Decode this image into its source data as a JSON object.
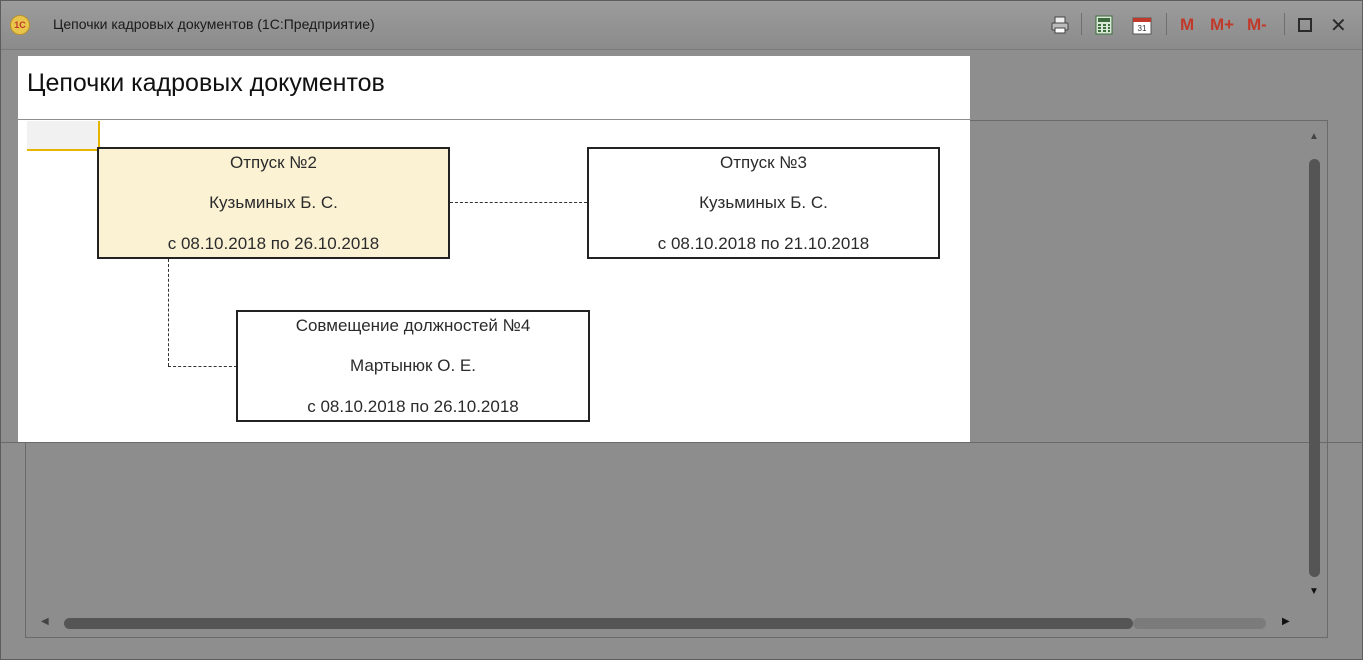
{
  "window": {
    "title": "Цепочки кадровых документов  (1С:Предприятие)",
    "logo_text": "1C",
    "toolbar": {
      "m_label": "M",
      "mplus_label": "M+",
      "mminus_label": "M-",
      "close_glyph": "✕"
    }
  },
  "page": {
    "title": "Цепочки кадровых документов"
  },
  "graph": {
    "nodes": [
      {
        "title": "Отпуск №2",
        "person": "Кузьминых Б. С.",
        "period": "с 08.10.2018 по 26.10.2018",
        "selected": true
      },
      {
        "title": "Отпуск №3",
        "person": "Кузьминых Б. С.",
        "period": "с 08.10.2018 по 21.10.2018",
        "selected": false
      },
      {
        "title": "Совмещение должностей №4",
        "person": "Мартынюк О. Е.",
        "period": "с 08.10.2018 по 26.10.2018",
        "selected": false
      }
    ]
  },
  "colors": {
    "selected_fill": "#fbf2d4",
    "corner_accent": "#e7b500",
    "memory_buttons": "#c0392b"
  }
}
